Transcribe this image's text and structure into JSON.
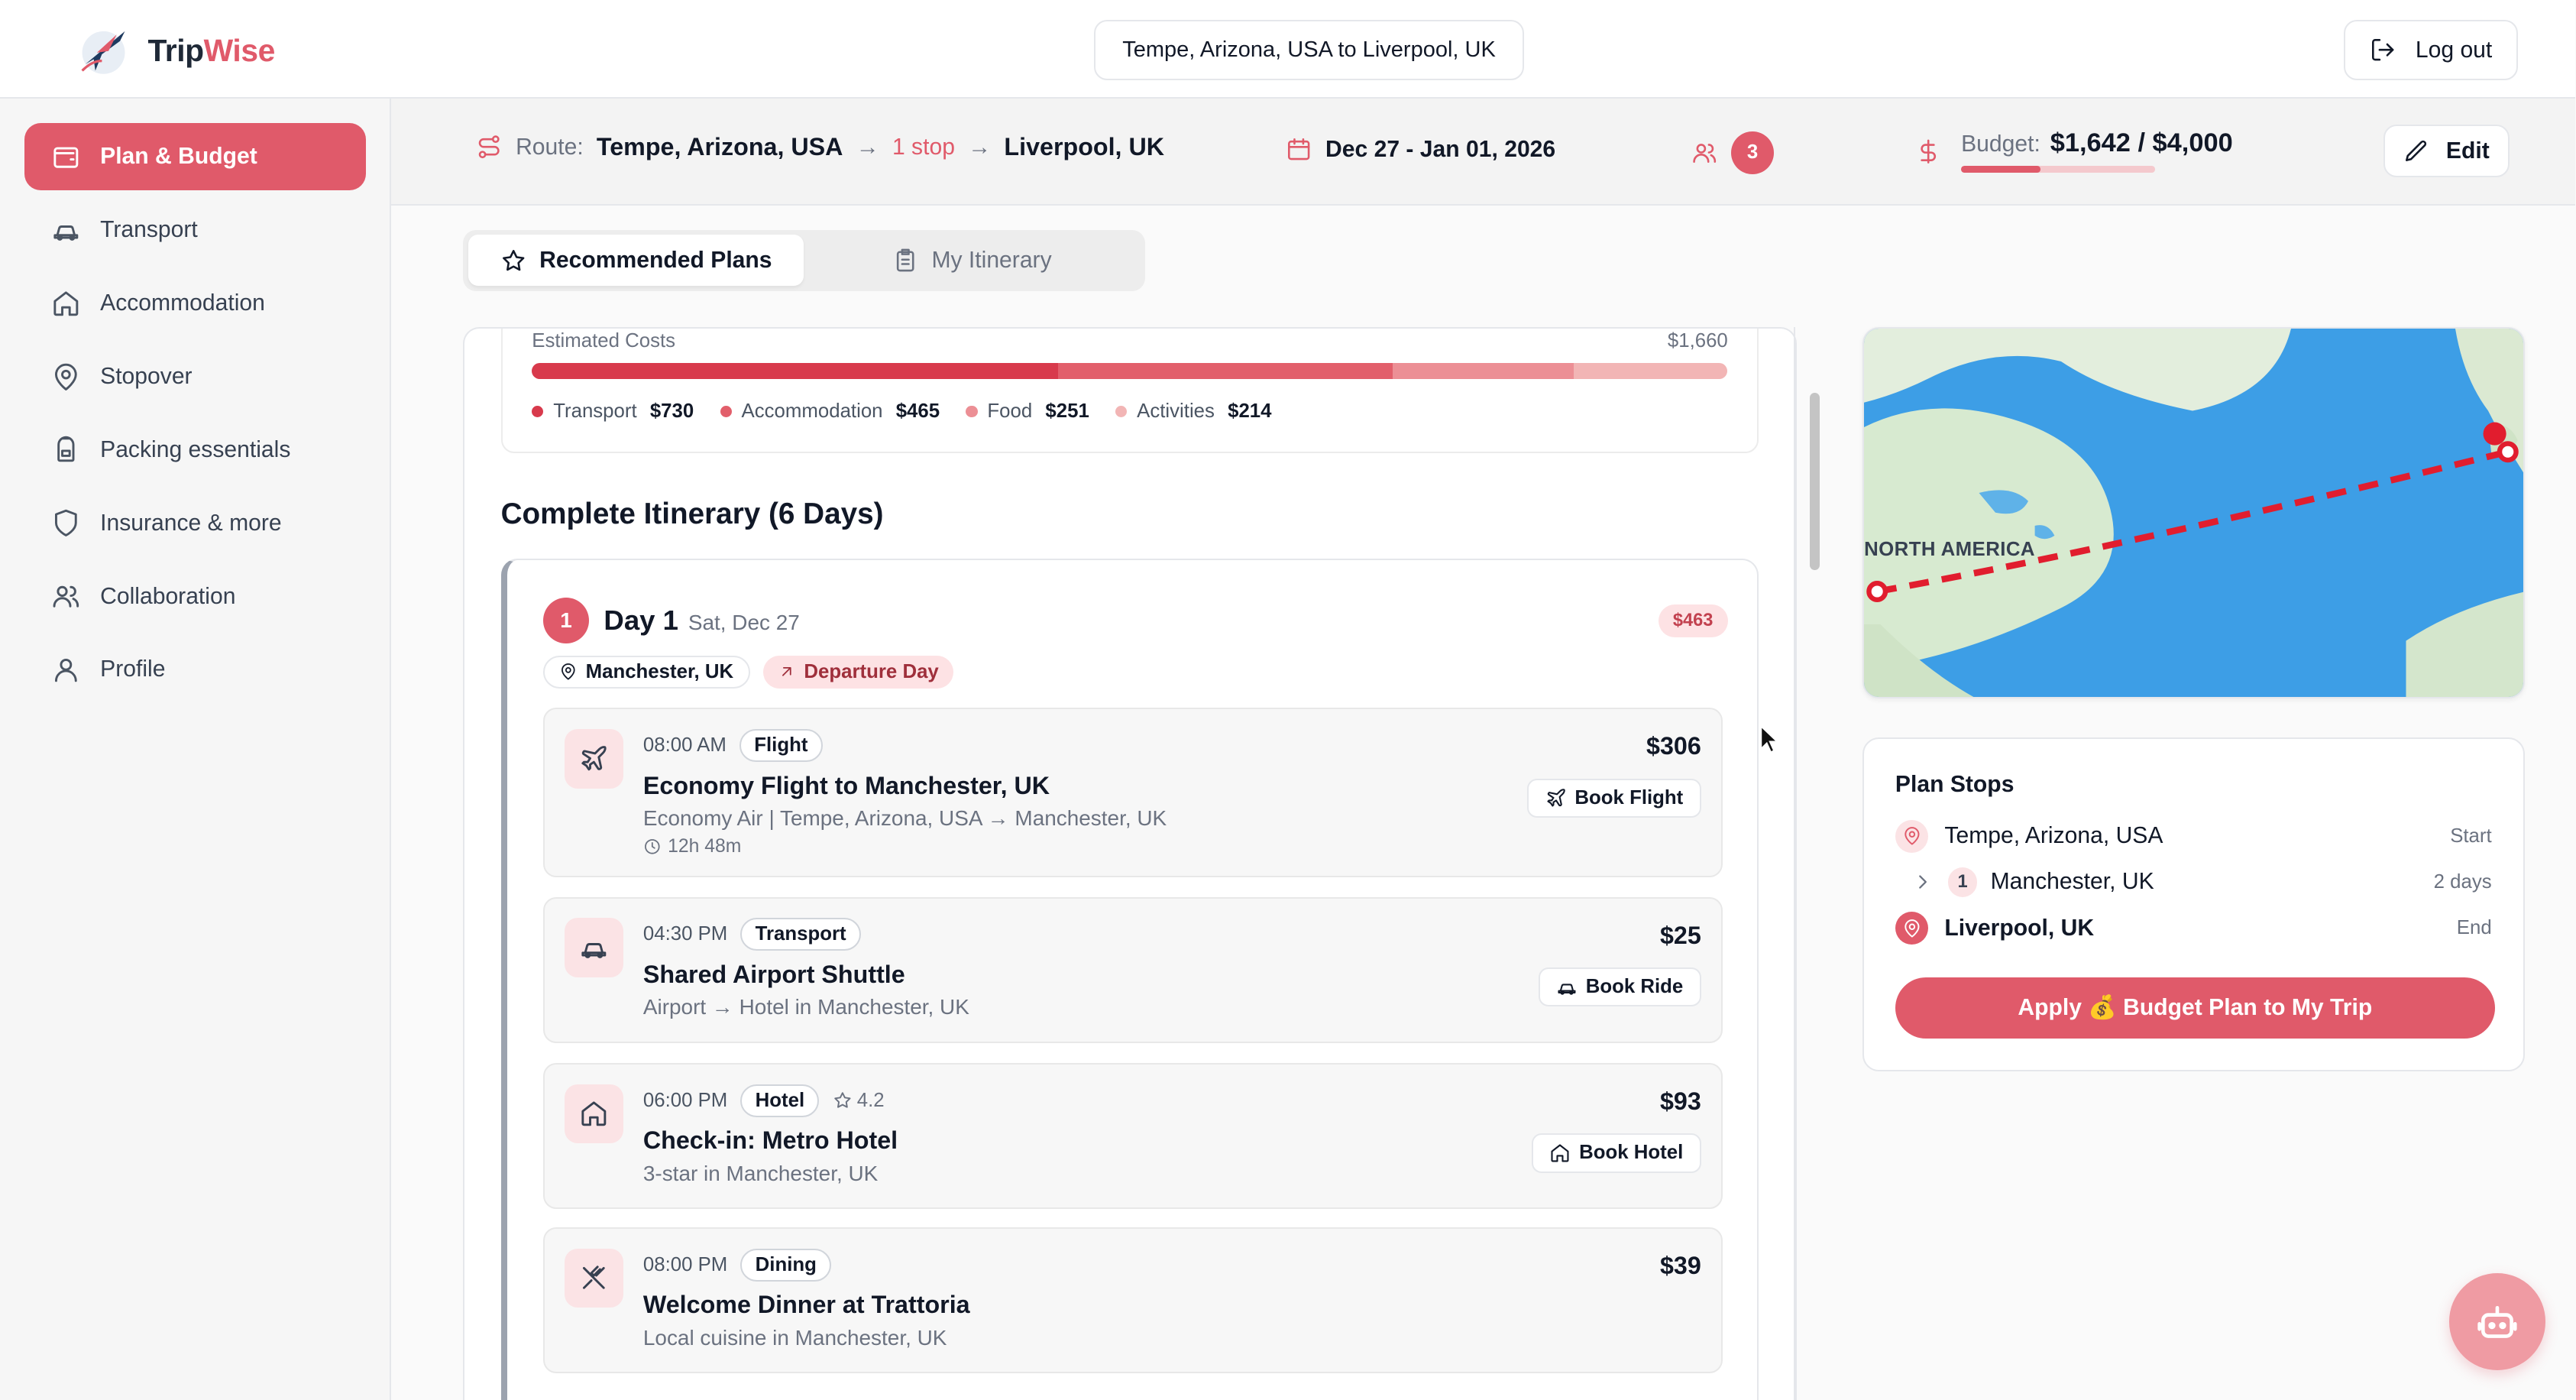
{
  "app": {
    "name_part1": "Trip",
    "name_part2": "Wise"
  },
  "header": {
    "route_pill": "Tempe, Arizona, USA to Liverpool, UK",
    "logout_label": "Log out"
  },
  "sidebar": {
    "items": [
      {
        "label": "Plan & Budget",
        "icon": "wallet-icon",
        "active": true
      },
      {
        "label": "Transport",
        "icon": "car-icon"
      },
      {
        "label": "Accommodation",
        "icon": "home-icon"
      },
      {
        "label": "Stopover",
        "icon": "map-pin-icon"
      },
      {
        "label": "Packing essentials",
        "icon": "backpack-icon"
      },
      {
        "label": "Insurance & more",
        "icon": "shield-icon"
      },
      {
        "label": "Collaboration",
        "icon": "users-icon"
      },
      {
        "label": "Profile",
        "icon": "user-icon"
      }
    ]
  },
  "summary": {
    "route_label": "Route:",
    "origin": "Tempe, Arizona, USA",
    "stops": "1 stop",
    "destination": "Liverpool, UK",
    "dates": "Dec 27 - Jan 01, 2026",
    "travelers": "3",
    "budget_label": "Budget:",
    "budget_value": "$1,642 / $4,000",
    "budget_used_fraction": 0.41,
    "edit_label": "Edit"
  },
  "tabs": [
    {
      "label": "Recommended Plans",
      "icon": "star-icon",
      "active": true
    },
    {
      "label": "My Itinerary",
      "icon": "clipboard-icon",
      "active": false
    }
  ],
  "costs": {
    "title": "Estimated Costs",
    "total": "$1,660",
    "segments": [
      {
        "name": "Transport",
        "amount": "$730",
        "value": 730,
        "color": "#d83a4c"
      },
      {
        "name": "Accommodation",
        "amount": "$465",
        "value": 465,
        "color": "#e25f6b"
      },
      {
        "name": "Food",
        "amount": "$251",
        "value": 251,
        "color": "#ec8f95"
      },
      {
        "name": "Activities",
        "amount": "$214",
        "value": 214,
        "color": "#f2b5b5"
      }
    ]
  },
  "itinerary": {
    "title": "Complete Itinerary (6 Days)",
    "day": {
      "number": "1",
      "title": "Day 1",
      "date": "Sat, Dec 27",
      "cost": "$463",
      "location": "Manchester, UK",
      "tag": "Departure Day",
      "activities": [
        {
          "time": "08:00 AM",
          "type": "Flight",
          "name": "Economy Flight to Manchester, UK",
          "sub": "Economy Air | Tempe, Arizona, USA → Manchester, UK",
          "duration": "12h 48m",
          "price": "$306",
          "action": "Book Flight",
          "icon": "plane-icon"
        },
        {
          "time": "04:30 PM",
          "type": "Transport",
          "name": "Shared Airport Shuttle",
          "sub": "Airport → Hotel in Manchester, UK",
          "price": "$25",
          "action": "Book Ride",
          "icon": "car-icon"
        },
        {
          "time": "06:00 PM",
          "type": "Hotel",
          "rating": "4.2",
          "name": "Check-in: Metro Hotel",
          "sub": "3-star in Manchester, UK",
          "price": "$93",
          "action": "Book Hotel",
          "icon": "home-icon"
        },
        {
          "time": "08:00 PM",
          "type": "Dining",
          "name": "Welcome Dinner at Trattoria",
          "sub": "Local cuisine in Manchester, UK",
          "price": "$39",
          "icon": "utensils-icon"
        }
      ]
    }
  },
  "map": {
    "label": "NORTH AMERICA"
  },
  "plan_stops": {
    "title": "Plan Stops",
    "stops": [
      {
        "number": "",
        "name": "Tempe, Arizona, USA",
        "note": "Start"
      },
      {
        "number": "1",
        "name": "Manchester, UK",
        "note": "2 days"
      },
      {
        "number": "",
        "name": "Liverpool, UK",
        "note": "End"
      }
    ],
    "apply_label": "Apply 💰 Budget Plan to My Trip"
  },
  "colors": {
    "accent": "#e05a6a",
    "accent_light": "#fde2e4"
  }
}
